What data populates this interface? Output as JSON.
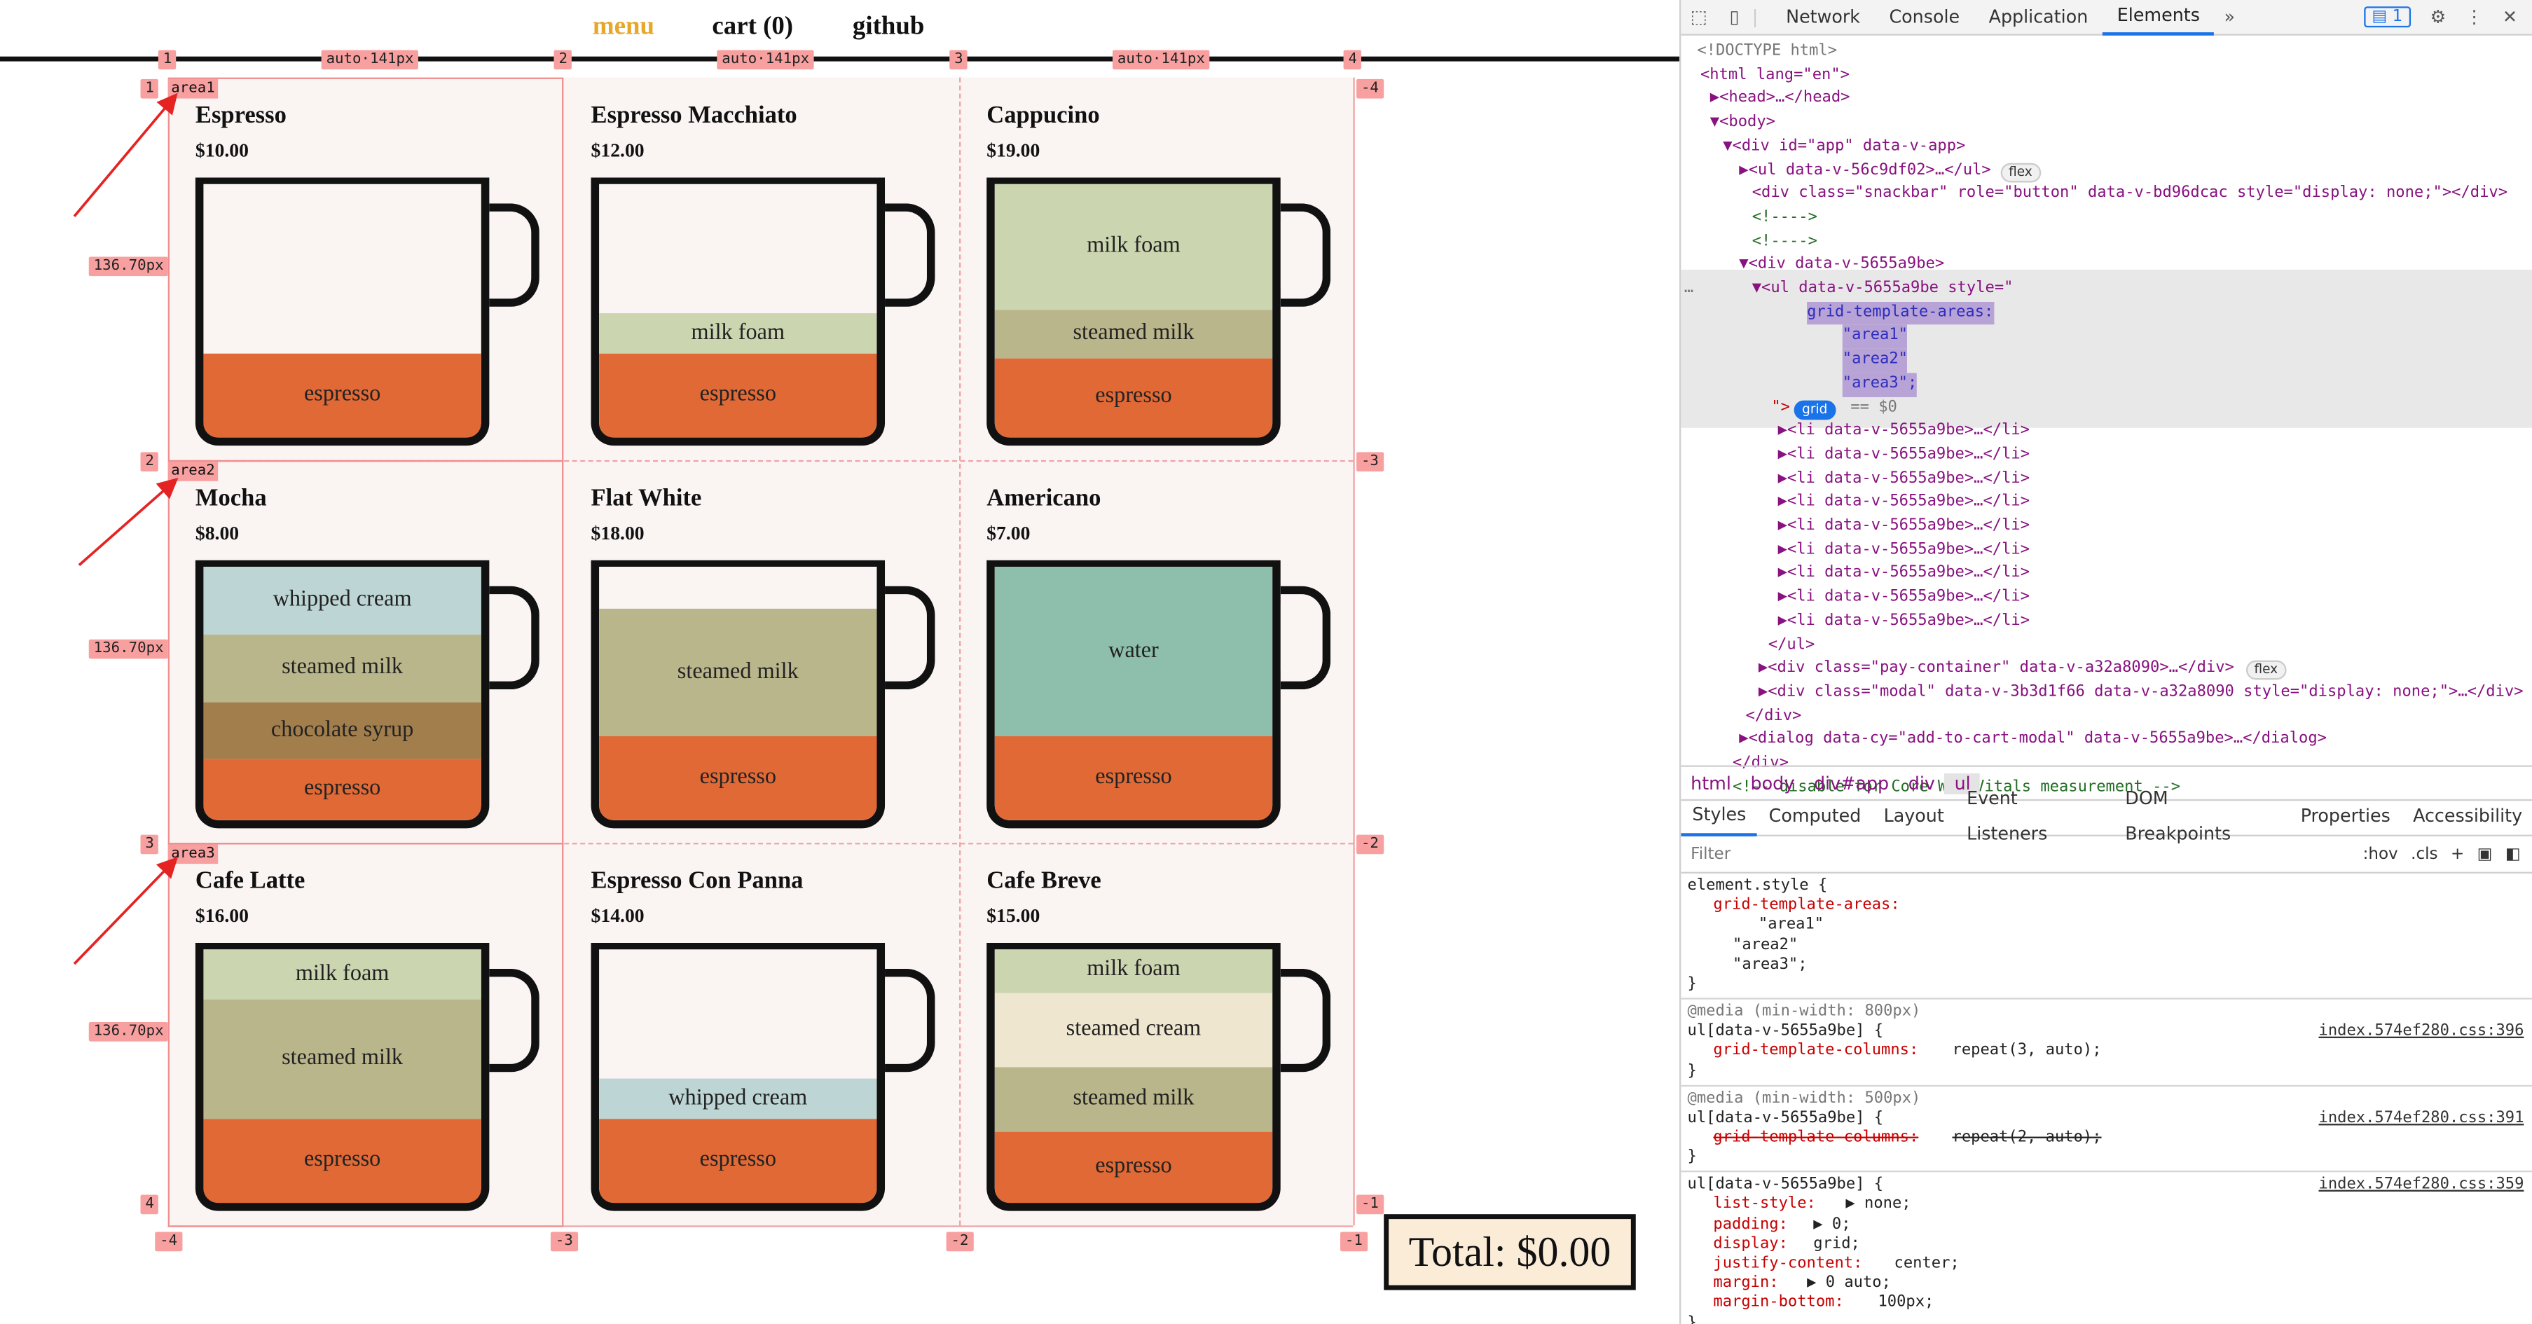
{
  "nav": {
    "menu": "menu",
    "cart": "cart (0)",
    "github": "github"
  },
  "grid_overlay": {
    "col_labels": [
      "auto·141px",
      "auto·141px",
      "auto·141px"
    ],
    "row_size": "136.70px",
    "top_lines": [
      "1",
      "2",
      "3",
      "4"
    ],
    "bottom_lines": [
      "-4",
      "-3",
      "-2",
      "-1"
    ],
    "left_lines": [
      "1",
      "2",
      "3",
      "4"
    ],
    "right_lines": [
      "-4",
      "-3",
      "-2",
      "-1"
    ],
    "areas": [
      "area1",
      "area2",
      "area3"
    ]
  },
  "menu": [
    {
      "name": "Espresso",
      "price": "$10.00",
      "layers": [
        {
          "label": "espresso",
          "color": "#e06936",
          "ratio": 0.33
        }
      ]
    },
    {
      "name": "Espresso Macchiato",
      "price": "$12.00",
      "layers": [
        {
          "label": "milk foam",
          "color": "#cbd5b0",
          "ratio": 0.16
        },
        {
          "label": "espresso",
          "color": "#e06936",
          "ratio": 0.33
        }
      ]
    },
    {
      "name": "Cappucino",
      "price": "$19.00",
      "layers": [
        {
          "label": "milk foam",
          "color": "#cbd5b0",
          "ratio": 0.52
        },
        {
          "label": "steamed milk",
          "color": "#b9b68b",
          "ratio": 0.2
        },
        {
          "label": "espresso",
          "color": "#e06936",
          "ratio": 0.33
        }
      ]
    },
    {
      "name": "Mocha",
      "price": "$8.00",
      "layers": [
        {
          "label": "whipped cream",
          "color": "#bdd5d4",
          "ratio": 0.27
        },
        {
          "label": "steamed milk",
          "color": "#b9b68b",
          "ratio": 0.27
        },
        {
          "label": "chocolate syrup",
          "color": "#a17e4b",
          "ratio": 0.22
        },
        {
          "label": "espresso",
          "color": "#e06936",
          "ratio": 0.24
        }
      ]
    },
    {
      "name": "Flat White",
      "price": "$18.00",
      "layers": [
        {
          "label": "steamed milk",
          "color": "#b9b68b",
          "ratio": 0.5
        },
        {
          "label": "espresso",
          "color": "#e06936",
          "ratio": 0.33
        }
      ]
    },
    {
      "name": "Americano",
      "price": "$7.00",
      "layers": [
        {
          "label": "water",
          "color": "#8ebfac",
          "ratio": 0.67
        },
        {
          "label": "espresso",
          "color": "#e06936",
          "ratio": 0.33
        }
      ]
    },
    {
      "name": "Cafe Latte",
      "price": "$16.00",
      "layers": [
        {
          "label": "milk foam",
          "color": "#cbd5b0",
          "ratio": 0.2
        },
        {
          "label": "steamed milk",
          "color": "#b9b68b",
          "ratio": 0.47
        },
        {
          "label": "espresso",
          "color": "#e06936",
          "ratio": 0.33
        }
      ]
    },
    {
      "name": "Espresso Con Panna",
      "price": "$14.00",
      "layers": [
        {
          "label": "whipped cream",
          "color": "#bdd5d4",
          "ratio": 0.16
        },
        {
          "label": "espresso",
          "color": "#e06936",
          "ratio": 0.33
        }
      ]
    },
    {
      "name": "Cafe Breve",
      "price": "$15.00",
      "layers": [
        {
          "label": "milk foam",
          "color": "#cbd5b0",
          "ratio": 0.17
        },
        {
          "label": "steamed cream",
          "color": "#efe6cf",
          "ratio": 0.29
        },
        {
          "label": "steamed milk",
          "color": "#b9b68b",
          "ratio": 0.26
        },
        {
          "label": "espresso",
          "color": "#e06936",
          "ratio": 0.28
        }
      ]
    }
  ],
  "total": "Total: $0.00",
  "devtools": {
    "tabs": [
      "Network",
      "Console",
      "Application",
      "Elements"
    ],
    "active_tab": "Elements",
    "issues_count": "1",
    "tree": [
      "<!DOCTYPE html>",
      "<html lang=\"en\">",
      "▶<head>…</head>",
      "▼<body>",
      "▼<div id=\"app\" data-v-app>",
      "▶<ul data-v-56c9df02>…</ul>",
      "<div class=\"snackbar\" role=\"button\" data-v-bd96dcac style=\"display: none;\"></div>",
      "<!---->",
      "<!---->",
      "▼<div data-v-5655a9be>",
      "▼<ul data-v-5655a9be style=\"",
      "grid-template-areas:",
      "\"area1\"",
      "\"area2\"",
      "\"area3\";",
      "\">",
      "▶<li data-v-5655a9be>…</li>",
      "▶<li data-v-5655a9be>…</li>",
      "▶<li data-v-5655a9be>…</li>",
      "▶<li data-v-5655a9be>…</li>",
      "▶<li data-v-5655a9be>…</li>",
      "▶<li data-v-5655a9be>…</li>",
      "▶<li data-v-5655a9be>…</li>",
      "▶<li data-v-5655a9be>…</li>",
      "▶<li data-v-5655a9be>…</li>",
      "</ul>",
      "▶<div class=\"pay-container\" data-v-a32a8090>…</div>",
      "▶<div class=\"modal\" data-v-3b3d1f66 data-v-a32a8090 style=\"display: none;\">…</div>",
      "</div>",
      "▶<dialog data-cy=\"add-to-cart-modal\" data-v-5655a9be>…</dialog>",
      "</div>",
      "<!-- disable for Core Web Vitals measurement -->"
    ],
    "badges": {
      "flex": "flex",
      "grid": "grid",
      "dollar0": "== $0"
    },
    "crumbs": [
      "html",
      "body",
      "div#app",
      "div",
      "ul"
    ],
    "subtabs": [
      "Styles",
      "Computed",
      "Layout",
      "Event Listeners",
      "DOM Breakpoints",
      "Properties",
      "Accessibility"
    ],
    "filter_placeholder": "Filter",
    "filter_tools": [
      ":hov",
      ".cls",
      "+"
    ],
    "styles": [
      {
        "selector": "element.style {",
        "rules": [
          [
            "grid-template-areas:",
            ""
          ],
          [
            "",
            "\"area1\""
          ],
          [
            "",
            "\"area2\""
          ],
          [
            "",
            "\"area3\";"
          ]
        ],
        "src": ""
      },
      {
        "media": "@media (min-width: 800px)",
        "selector": "ul[data-v-5655a9be] {",
        "rules": [
          [
            "grid-template-columns:",
            "repeat(3, auto);"
          ]
        ],
        "src": "index.574ef280.css:396"
      },
      {
        "media": "@media (min-width: 500px)",
        "selector": "ul[data-v-5655a9be] {",
        "rules": [
          [
            "grid-template-columns:",
            "repeat(2, auto);"
          ]
        ],
        "src": "index.574ef280.css:391"
      },
      {
        "selector": "ul[data-v-5655a9be] {",
        "rules": [
          [
            "list-style:",
            "▶ none;"
          ],
          [
            "padding:",
            "▶ 0;"
          ],
          [
            "display:",
            "grid;"
          ],
          [
            "justify-content:",
            "center;"
          ],
          [
            "margin:",
            "▶ 0 auto;"
          ],
          [
            "margin-bottom:",
            "100px;"
          ]
        ],
        "src": "index.574ef280.css:359"
      }
    ]
  }
}
